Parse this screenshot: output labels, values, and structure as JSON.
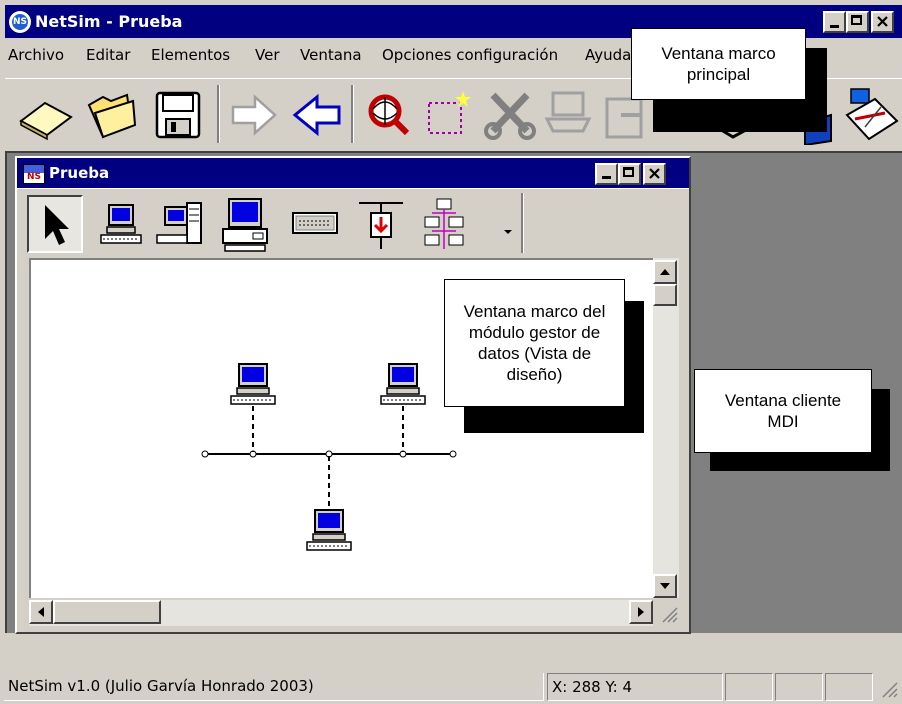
{
  "app": {
    "title": "NetSim - Prueba",
    "menu": [
      "Archivo",
      "Editar",
      "Elementos",
      "Ver",
      "Ventana",
      "Opciones configuración",
      "Ayuda"
    ]
  },
  "main_toolbar": {
    "icons": [
      "new-icon",
      "open-folder-icon",
      "save-floppy-icon",
      "forward-arrow-icon",
      "back-arrow-icon",
      "search-globe-icon",
      "selection-icon",
      "cut-tools-icon",
      "network-wizard-icon",
      "export-icon",
      "collapse-icon",
      "book-icon",
      "network-map-icon"
    ]
  },
  "child_window": {
    "title": "Prueba",
    "palette_icons": [
      "pointer-icon",
      "workstation-icon",
      "server-tower-icon",
      "desktop-pc-icon",
      "hub-icon",
      "bus-terminator-icon",
      "network-group-icon"
    ]
  },
  "status_bar": {
    "description": "NetSim v1.0 (Julio Garvía Honrado 2003)",
    "coordinates": "X: 288 Y: 4"
  },
  "annotations": {
    "main_frame": "Ventana marco principal",
    "module_frame": "Ventana marco del módulo gestor de datos (Vista de diseño)",
    "mdi_client": "Ventana cliente MDI"
  },
  "colors": {
    "title_bar": "#000080",
    "face": "#d4d0c8",
    "mdi_background": "#808080"
  }
}
